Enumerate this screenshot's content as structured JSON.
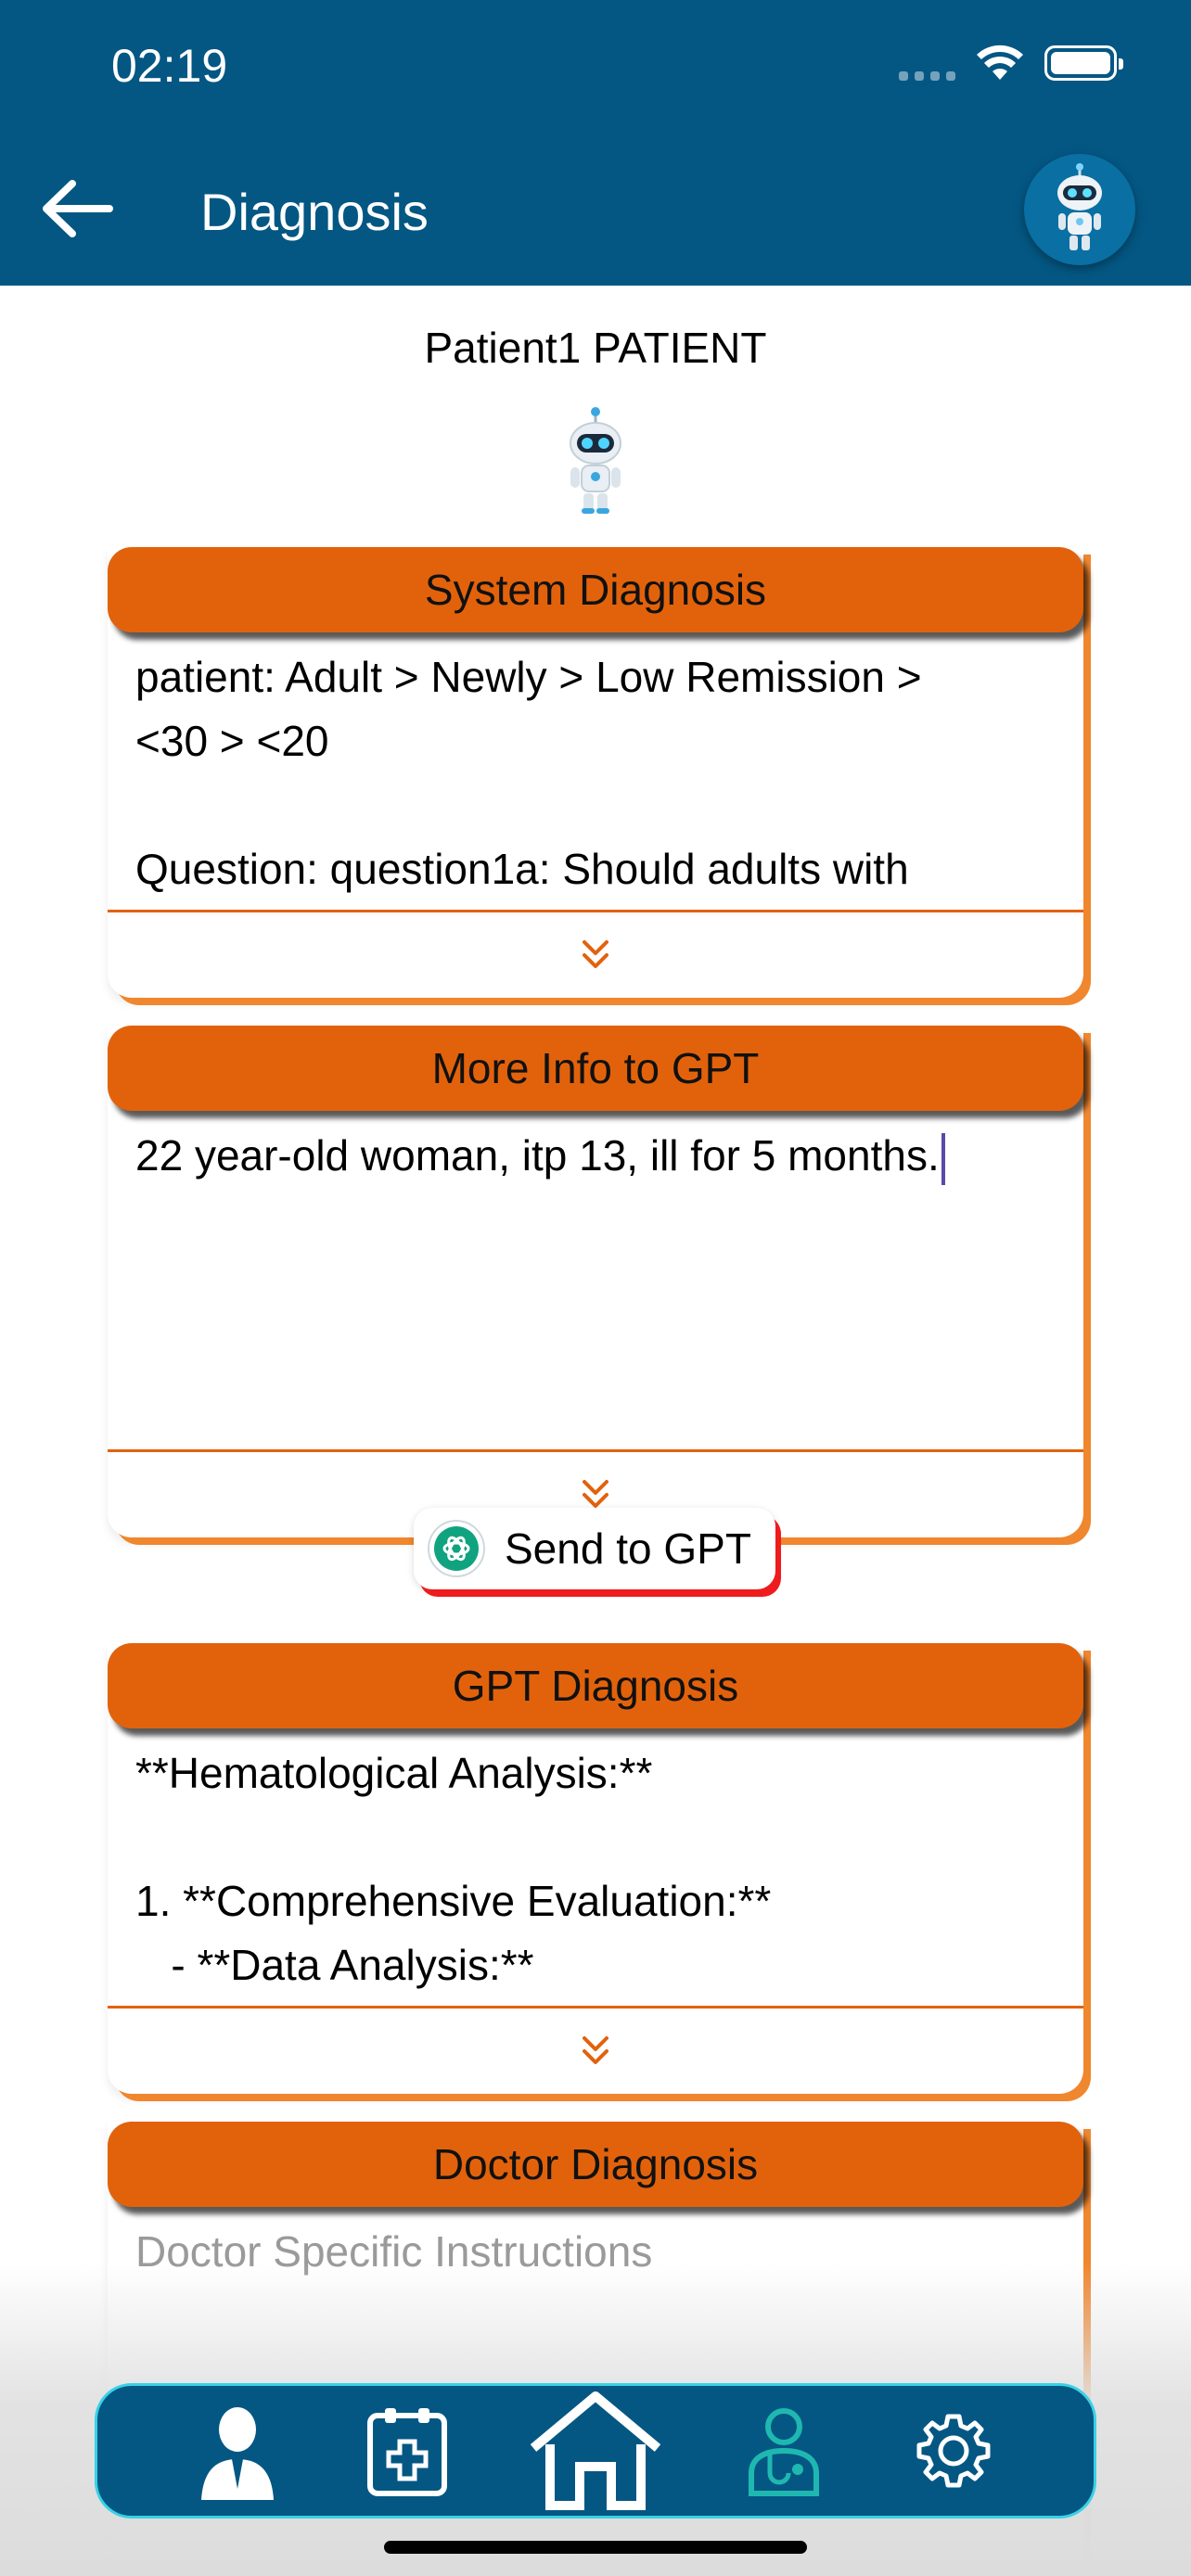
{
  "status_bar": {
    "time": "02:19"
  },
  "header": {
    "title": "Diagnosis"
  },
  "patient": {
    "name": "Patient1 PATIENT"
  },
  "system_diagnosis": {
    "title": "System Diagnosis",
    "text": "patient: Adult > Newly > Low Remission >\n<30 > <20\n\nQuestion: question1a: Should adults with"
  },
  "more_info": {
    "title": "More Info to GPT",
    "value": "22 year-old woman, itp 13, ill for 5 months."
  },
  "send_button": {
    "label": "Send to GPT"
  },
  "gpt_diagnosis": {
    "title": "GPT Diagnosis",
    "text": "**Hematological Analysis:**\n\n1. **Comprehensive Evaluation:**\n   - **Data Analysis:**"
  },
  "doctor_diagnosis": {
    "title": "Doctor Diagnosis",
    "placeholder": "Doctor Specific Instructions"
  },
  "nav": {
    "items": [
      "profile-icon",
      "medical-clipboard-icon",
      "home-icon",
      "doctor-icon",
      "settings-icon"
    ],
    "active": "doctor-icon"
  },
  "colors": {
    "header_bg": "#045783",
    "card_header": "#e2620c",
    "accent_orange": "#f0862e",
    "send_shadow": "#ee1c1c",
    "nav_border": "#39d1e6",
    "nav_active": "#1fb8b0"
  }
}
